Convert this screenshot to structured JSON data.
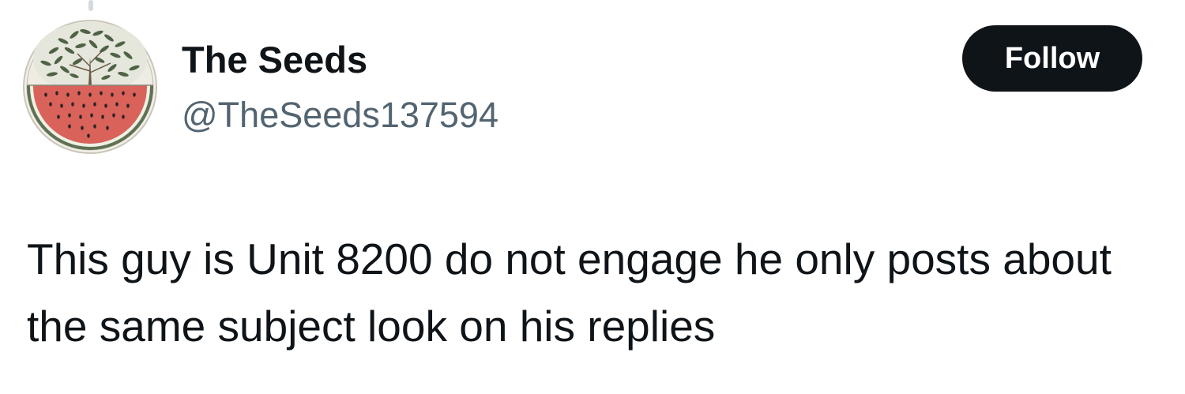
{
  "tweet": {
    "author": {
      "display_name": "The Seeds",
      "handle": "@TheSeeds137594",
      "avatar_icon": "watermelon-olive-tree-avatar"
    },
    "follow_label": "Follow",
    "text": "This guy is Unit 8200 do not engage he only posts about the same subject look on his replies"
  },
  "colors": {
    "text_primary": "#0f1419",
    "text_secondary": "#536471",
    "follow_bg": "#0f1419",
    "follow_text": "#ffffff",
    "avatar_red": "#d9625a",
    "avatar_green": "#5e7152"
  }
}
